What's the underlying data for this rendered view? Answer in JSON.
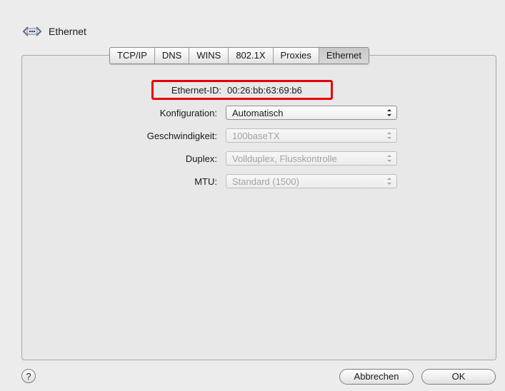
{
  "header": {
    "title": "Ethernet",
    "icon": "ethernet-icon"
  },
  "tabs": [
    {
      "label": "TCP/IP"
    },
    {
      "label": "DNS"
    },
    {
      "label": "WINS"
    },
    {
      "label": "802.1X"
    },
    {
      "label": "Proxies"
    },
    {
      "label": "Ethernet",
      "active": true
    }
  ],
  "form": {
    "ethernet_id_label": "Ethernet-ID:",
    "ethernet_id_value": "00:26:bb:63:69:b6",
    "konfiguration_label": "Konfiguration:",
    "konfiguration_value": "Automatisch",
    "geschwindigkeit_label": "Geschwindigkeit:",
    "geschwindigkeit_value": "100baseTX",
    "duplex_label": "Duplex:",
    "duplex_value": "Vollduplex, Flusskontrolle",
    "mtu_label": "MTU:",
    "mtu_value": "Standard (1500)"
  },
  "footer": {
    "help_label": "?",
    "cancel_label": "Abbrechen",
    "ok_label": "OK"
  },
  "colors": {
    "highlight": "#e60000"
  }
}
